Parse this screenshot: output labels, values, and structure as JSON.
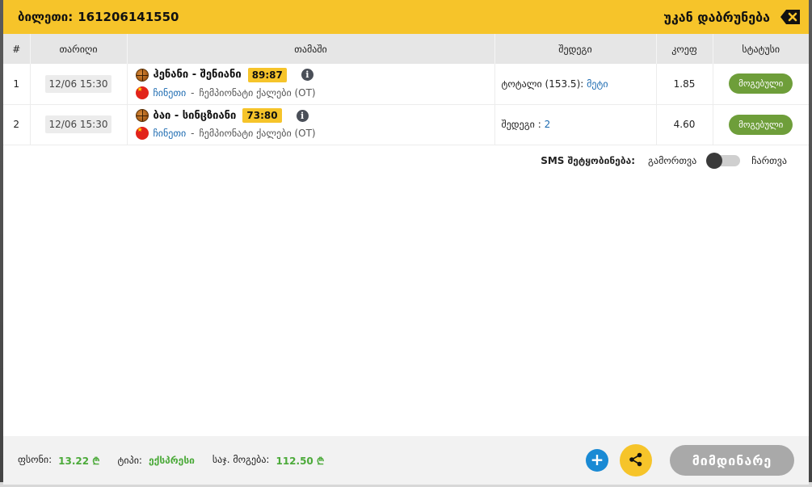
{
  "header": {
    "ticket_label": "ბილეთი:",
    "ticket_number": "161206141550",
    "back_label": "უკან დაბრუნება",
    "back_icon": "backspace-icon"
  },
  "table": {
    "columns": [
      "#",
      "თარიღი",
      "თამაში",
      "შედეგი",
      "კოეფ",
      "სტატუსი"
    ],
    "rows": [
      {
        "num": "1",
        "date": "12/06 15:30",
        "teams": "ჰენანი - შენიანი",
        "score": "89:87",
        "country": "ჩინეთი",
        "separator": "-",
        "league": "ჩემპიონატი ქალები (OT)",
        "result_label": "ტოტალი (153.5):",
        "result_pick": "მეტი",
        "odds": "1.85",
        "status": "მოგებული"
      },
      {
        "num": "2",
        "date": "12/06 15:30",
        "teams": "ბაი - სინცზიანი",
        "score": "73:80",
        "country": "ჩინეთი",
        "separator": "-",
        "league": "ჩემპიონატი ქალები (OT)",
        "result_label": "შედეგი :",
        "result_pick": "2",
        "odds": "4.60",
        "status": "მოგებული"
      }
    ]
  },
  "sms": {
    "label": "SMS შეტყობინება:",
    "off_label": "გამორთვა",
    "on_label": "ჩართვა",
    "enabled": false
  },
  "footer": {
    "stake_label": "ფსონი:",
    "stake_value": "13.22 ₾",
    "type_label": "ტიპი:",
    "type_value": "ექსპრესი",
    "max_win_label": "საჯ. მოგება:",
    "max_win_value": "112.50 ₾",
    "plus_symbol": "+",
    "current_label": "მიმდინარე"
  },
  "colors": {
    "header_bg": "#f6c42a",
    "win_green": "#6e9e3a",
    "link_blue": "#1d6bb1",
    "footer_value_green": "#4caa3a",
    "plus_blue": "#1a8ad4",
    "current_gray": "#a9a9a9"
  }
}
